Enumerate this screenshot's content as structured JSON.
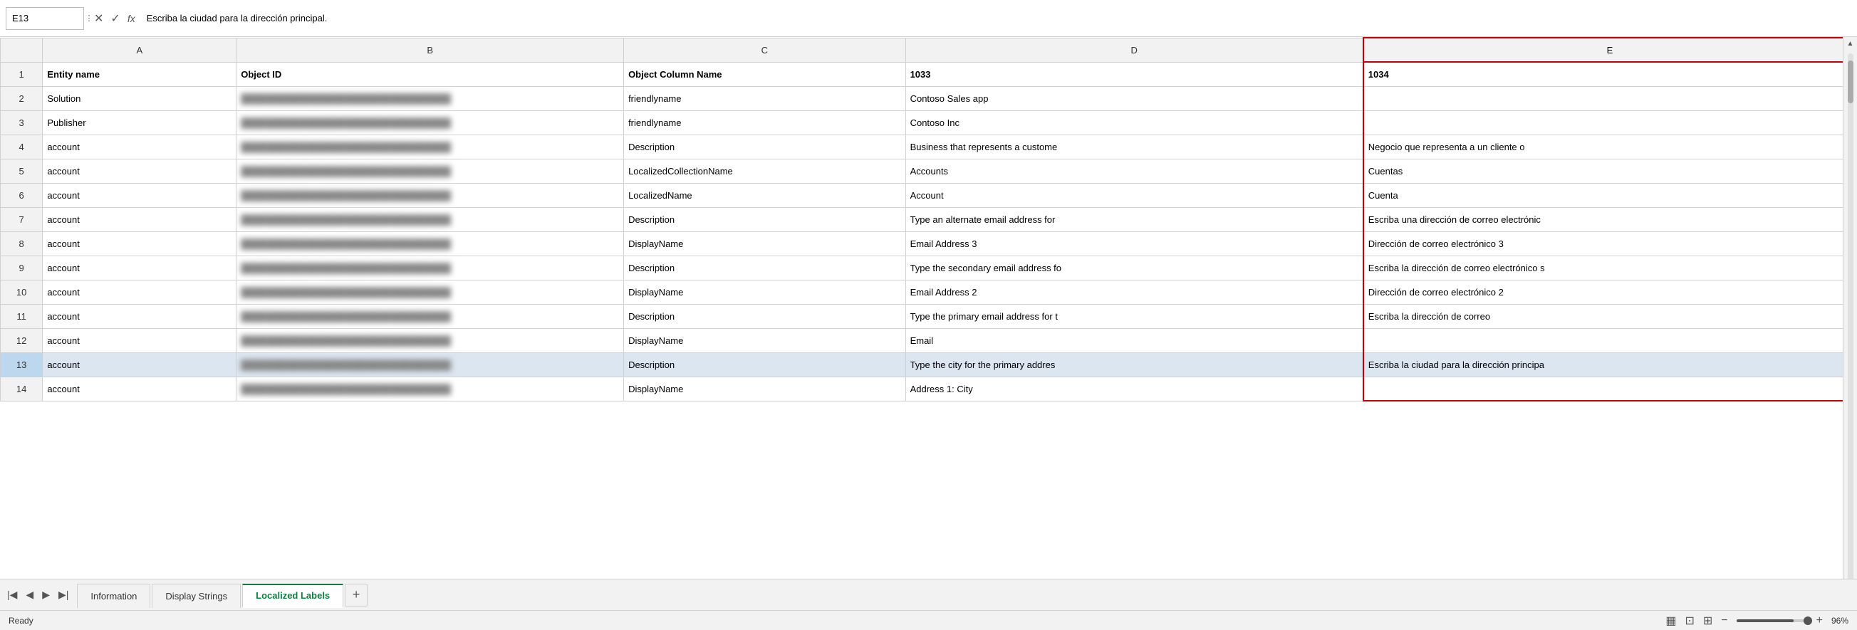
{
  "formulaBar": {
    "cellRef": "E13",
    "cancelLabel": "✕",
    "confirmLabel": "✓",
    "fxLabel": "fx",
    "formulaValue": "Escriba la ciudad para la dirección principal."
  },
  "columns": {
    "rowNum": "#",
    "A": "A",
    "B": "B",
    "C": "C",
    "D": "D",
    "E": "E"
  },
  "headers": {
    "row1": {
      "A": "Entity name",
      "B": "Object ID",
      "C": "Object Column Name",
      "D": "1033",
      "E": "1034"
    }
  },
  "rows": [
    {
      "num": "2",
      "A": "Solution",
      "B": "BLURRED",
      "C": "friendlyname",
      "D": "Contoso Sales app",
      "E": ""
    },
    {
      "num": "3",
      "A": "Publisher",
      "B": "BLURRED",
      "C": "friendlyname",
      "D": "Contoso Inc",
      "E": ""
    },
    {
      "num": "4",
      "A": "account",
      "B": "BLURRED",
      "C": "Description",
      "D": "Business that represents a custome",
      "E": "Negocio que representa a un cliente o"
    },
    {
      "num": "5",
      "A": "account",
      "B": "BLURRED",
      "C": "LocalizedCollectionName",
      "D": "Accounts",
      "E": "Cuentas"
    },
    {
      "num": "6",
      "A": "account",
      "B": "BLURRED",
      "C": "LocalizedName",
      "D": "Account",
      "E": "Cuenta"
    },
    {
      "num": "7",
      "A": "account",
      "B": "BLURRED",
      "C": "Description",
      "D": "Type an alternate email address for",
      "E": "Escriba una dirección de correo electrónic"
    },
    {
      "num": "8",
      "A": "account",
      "B": "BLURRED",
      "C": "DisplayName",
      "D": "Email Address 3",
      "E": "Dirección de correo electrónico 3"
    },
    {
      "num": "9",
      "A": "account",
      "B": "BLURRED",
      "C": "Description",
      "D": "Type the secondary email address fo",
      "E": "Escriba la dirección de correo electrónico s"
    },
    {
      "num": "10",
      "A": "account",
      "B": "BLURRED",
      "C": "DisplayName",
      "D": "Email Address 2",
      "E": "Dirección de correo electrónico 2"
    },
    {
      "num": "11",
      "A": "account",
      "B": "BLURRED",
      "C": "Description",
      "D": "Type the primary email address for t",
      "E": "Escriba la dirección de correo"
    },
    {
      "num": "12",
      "A": "account",
      "B": "BLURRED",
      "C": "DisplayName",
      "D": "Email",
      "E": ""
    },
    {
      "num": "13",
      "A": "account",
      "B": "BLURRED",
      "C": "Description",
      "D": "Type the city for the primary addres",
      "E": "Escriba la ciudad para la dirección principa",
      "selected": true
    },
    {
      "num": "14",
      "A": "account",
      "B": "BLURRED",
      "C": "DisplayName",
      "D": "Address 1: City",
      "E": ""
    }
  ],
  "tabs": [
    {
      "id": "information",
      "label": "Information",
      "active": false
    },
    {
      "id": "display-strings",
      "label": "Display Strings",
      "active": false
    },
    {
      "id": "localized-labels",
      "label": "Localized Labels",
      "active": true
    }
  ],
  "tabAdd": "+",
  "status": {
    "ready": "Ready",
    "zoom": "96%"
  }
}
